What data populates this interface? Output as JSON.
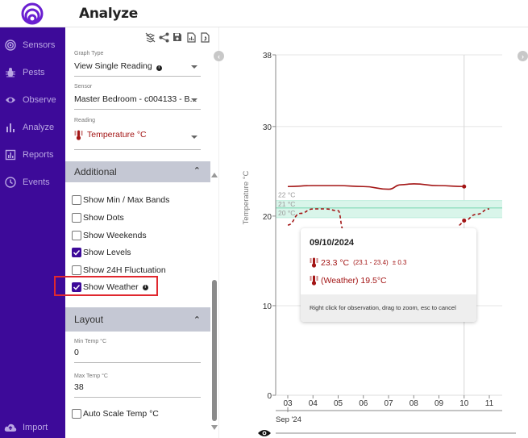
{
  "header": {
    "title": "Analyze",
    "logo": "rings-logo-icon"
  },
  "sidebar": {
    "items": [
      {
        "label": "Sensors",
        "icon": "sensor-signal-icon"
      },
      {
        "label": "Pests",
        "icon": "bug-icon"
      },
      {
        "label": "Observe",
        "icon": "eye-icon"
      },
      {
        "label": "Analyze",
        "icon": "bar-chart-icon"
      },
      {
        "label": "Reports",
        "icon": "report-icon"
      },
      {
        "label": "Events",
        "icon": "clock-icon"
      }
    ],
    "bottom": {
      "label": "Import",
      "icon": "cloud-upload-icon"
    }
  },
  "toolbar": {
    "icons": [
      "hide-layers-icon",
      "share-icon",
      "save-icon",
      "chart-report-icon",
      "csv-file-icon"
    ]
  },
  "form": {
    "graph_type": {
      "label": "Graph Type",
      "value": "View Single Reading"
    },
    "sensor": {
      "label": "Sensor",
      "value": "Master Bedroom - c004133 - B..."
    },
    "reading": {
      "label": "Reading",
      "value": "Temperature °C"
    }
  },
  "additional": {
    "title": "Additional",
    "options": [
      {
        "label": "Show Min / Max Bands",
        "checked": false
      },
      {
        "label": "Show Dots",
        "checked": false
      },
      {
        "label": "Show Weekends",
        "checked": false
      },
      {
        "label": "Show Levels",
        "checked": true
      },
      {
        "label": "Show 24H Fluctuation",
        "checked": false
      },
      {
        "label": "Show Weather",
        "checked": true
      }
    ]
  },
  "layout": {
    "title": "Layout",
    "min_temp": {
      "label": "Min Temp °C",
      "value": "0"
    },
    "max_temp": {
      "label": "Max Temp °C",
      "value": "38"
    },
    "auto_scale": {
      "label": "Auto Scale Temp °C",
      "checked": false
    }
  },
  "tooltip": {
    "date": "09/10/2024",
    "reading": "23.3 °C",
    "range": "(23.1 - 23.4)",
    "fluct": "± 0.3",
    "weather": "(Weather) 19.5°C",
    "footer": "Right click for observation, drag to zoom, esc to cancel"
  },
  "colors": {
    "brand": "#3d0a99",
    "reading_line": "#a31515",
    "level_band": "#d9f5ea",
    "level_line": "#7fd9b4",
    "highlight": "#e0282f"
  },
  "chart_data": {
    "type": "line",
    "ylabel": "Temperature °C",
    "xlabel": "Sep '24",
    "ylim": [
      0,
      38
    ],
    "yticks": [
      0,
      10,
      20,
      30,
      38
    ],
    "x": [
      "03",
      "04",
      "05",
      "06",
      "07",
      "08",
      "09",
      "10",
      "11"
    ],
    "levels": [
      {
        "label": "22 °C",
        "value": 22
      },
      {
        "label": "21 °C",
        "value": 21
      },
      {
        "label": "20 °C",
        "value": 20
      }
    ],
    "series": [
      {
        "name": "Temperature",
        "style": "solid",
        "x": [
          3,
          4,
          5,
          6,
          7,
          7.5,
          8,
          9,
          10
        ],
        "values": [
          23.3,
          23.4,
          23.4,
          23.3,
          23.0,
          23.5,
          23.6,
          23.4,
          23.3
        ]
      },
      {
        "name": "Weather",
        "style": "dashed",
        "x": [
          3,
          3.5,
          4,
          4.5,
          5,
          5.2
        ],
        "values": [
          19.0,
          20.3,
          20.8,
          20.8,
          20.6,
          18.5
        ]
      },
      {
        "name": "Weather",
        "style": "dashed",
        "x": [
          9.8,
          10,
          10.5,
          11
        ],
        "values": [
          19.0,
          19.5,
          20.2,
          20.8
        ]
      }
    ],
    "hover": {
      "x": 10,
      "temperature": 23.3,
      "weather": 19.5
    }
  }
}
